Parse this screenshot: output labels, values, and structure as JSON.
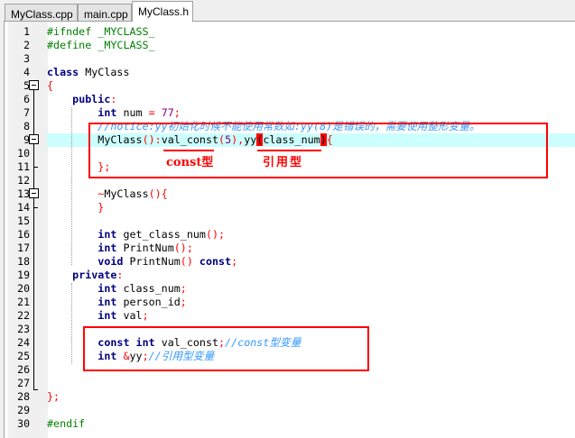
{
  "tabs": [
    {
      "label": "MyClass.cpp"
    },
    {
      "label": "main.cpp"
    },
    {
      "label": "MyClass.h",
      "active": true
    }
  ],
  "code": {
    "lines": [
      [
        [
          "#ifndef _MYCLASS_",
          "p"
        ]
      ],
      [
        [
          "#define _MYCLASS_",
          "p"
        ]
      ],
      [],
      [
        [
          "class",
          "k"
        ],
        [
          " MyClass",
          ""
        ]
      ],
      [
        [
          "{",
          "o"
        ]
      ],
      [
        [
          "    ",
          ""
        ],
        [
          "public",
          "k"
        ],
        [
          ":",
          "o"
        ]
      ],
      [
        [
          "        ",
          ""
        ],
        [
          "int",
          "k"
        ],
        [
          " num ",
          ""
        ],
        [
          "=",
          "o"
        ],
        [
          " ",
          ""
        ],
        [
          "77",
          "n"
        ],
        [
          ";",
          "o"
        ]
      ],
      [
        [
          "        ",
          ""
        ],
        [
          "//notice:yy初始化时候不能使用常数如:yy(8)是错误的，需要使用整形变量。",
          "c"
        ]
      ],
      [
        [
          "        MyClass",
          ""
        ],
        [
          "()",
          "o"
        ],
        [
          ":",
          "o"
        ],
        [
          "val_const",
          ""
        ],
        [
          "(",
          "o"
        ],
        [
          "5",
          "n"
        ],
        [
          ")",
          "o"
        ],
        [
          ",",
          "o"
        ],
        [
          "yy",
          ""
        ],
        [
          "(",
          "b"
        ],
        [
          "class_num",
          ""
        ],
        [
          ")",
          "b"
        ],
        [
          "{",
          "o"
        ]
      ],
      [],
      [
        [
          "        ",
          ""
        ],
        [
          "};",
          "o"
        ]
      ],
      [],
      [
        [
          "        ",
          ""
        ],
        [
          "~",
          "o"
        ],
        [
          "MyClass",
          ""
        ],
        [
          "(){",
          "o"
        ]
      ],
      [
        [
          "        ",
          ""
        ],
        [
          "}",
          "o"
        ]
      ],
      [],
      [
        [
          "        ",
          ""
        ],
        [
          "int",
          "k"
        ],
        [
          " get_class_num",
          ""
        ],
        [
          "();",
          "o"
        ]
      ],
      [
        [
          "        ",
          ""
        ],
        [
          "int",
          "k"
        ],
        [
          " PrintNum",
          ""
        ],
        [
          "();",
          "o"
        ]
      ],
      [
        [
          "        ",
          ""
        ],
        [
          "void",
          "k"
        ],
        [
          " PrintNum",
          ""
        ],
        [
          "()",
          "o"
        ],
        [
          " ",
          ""
        ],
        [
          "const",
          "k"
        ],
        [
          ";",
          "o"
        ]
      ],
      [
        [
          "    ",
          ""
        ],
        [
          "private",
          "k"
        ],
        [
          ":",
          "o"
        ]
      ],
      [
        [
          "        ",
          ""
        ],
        [
          "int",
          "k"
        ],
        [
          " class_num",
          ""
        ],
        [
          ";",
          "o"
        ]
      ],
      [
        [
          "        ",
          ""
        ],
        [
          "int",
          "k"
        ],
        [
          " person_id",
          ""
        ],
        [
          ";",
          "o"
        ]
      ],
      [
        [
          "        ",
          ""
        ],
        [
          "int",
          "k"
        ],
        [
          " val",
          ""
        ],
        [
          ";",
          "o"
        ]
      ],
      [],
      [
        [
          "        ",
          ""
        ],
        [
          "const",
          "k"
        ],
        [
          " ",
          ""
        ],
        [
          "int",
          "k"
        ],
        [
          " val_const",
          ""
        ],
        [
          ";",
          "o"
        ],
        [
          "//const型变量",
          "c"
        ]
      ],
      [
        [
          "        ",
          ""
        ],
        [
          "int",
          "k"
        ],
        [
          " ",
          ""
        ],
        [
          "&",
          "o"
        ],
        [
          "yy",
          ""
        ],
        [
          ";",
          "o"
        ],
        [
          "//引用型变量",
          "c"
        ]
      ],
      [],
      [],
      [
        [
          "};",
          "o"
        ]
      ],
      [],
      [
        [
          "#endif",
          "p"
        ]
      ]
    ],
    "highlight_line": 9
  },
  "annotations": {
    "const_label": "const型",
    "ref_label": "引用型"
  },
  "colors": {
    "annotation": "#ff0000",
    "current_line": "#ccffff"
  }
}
